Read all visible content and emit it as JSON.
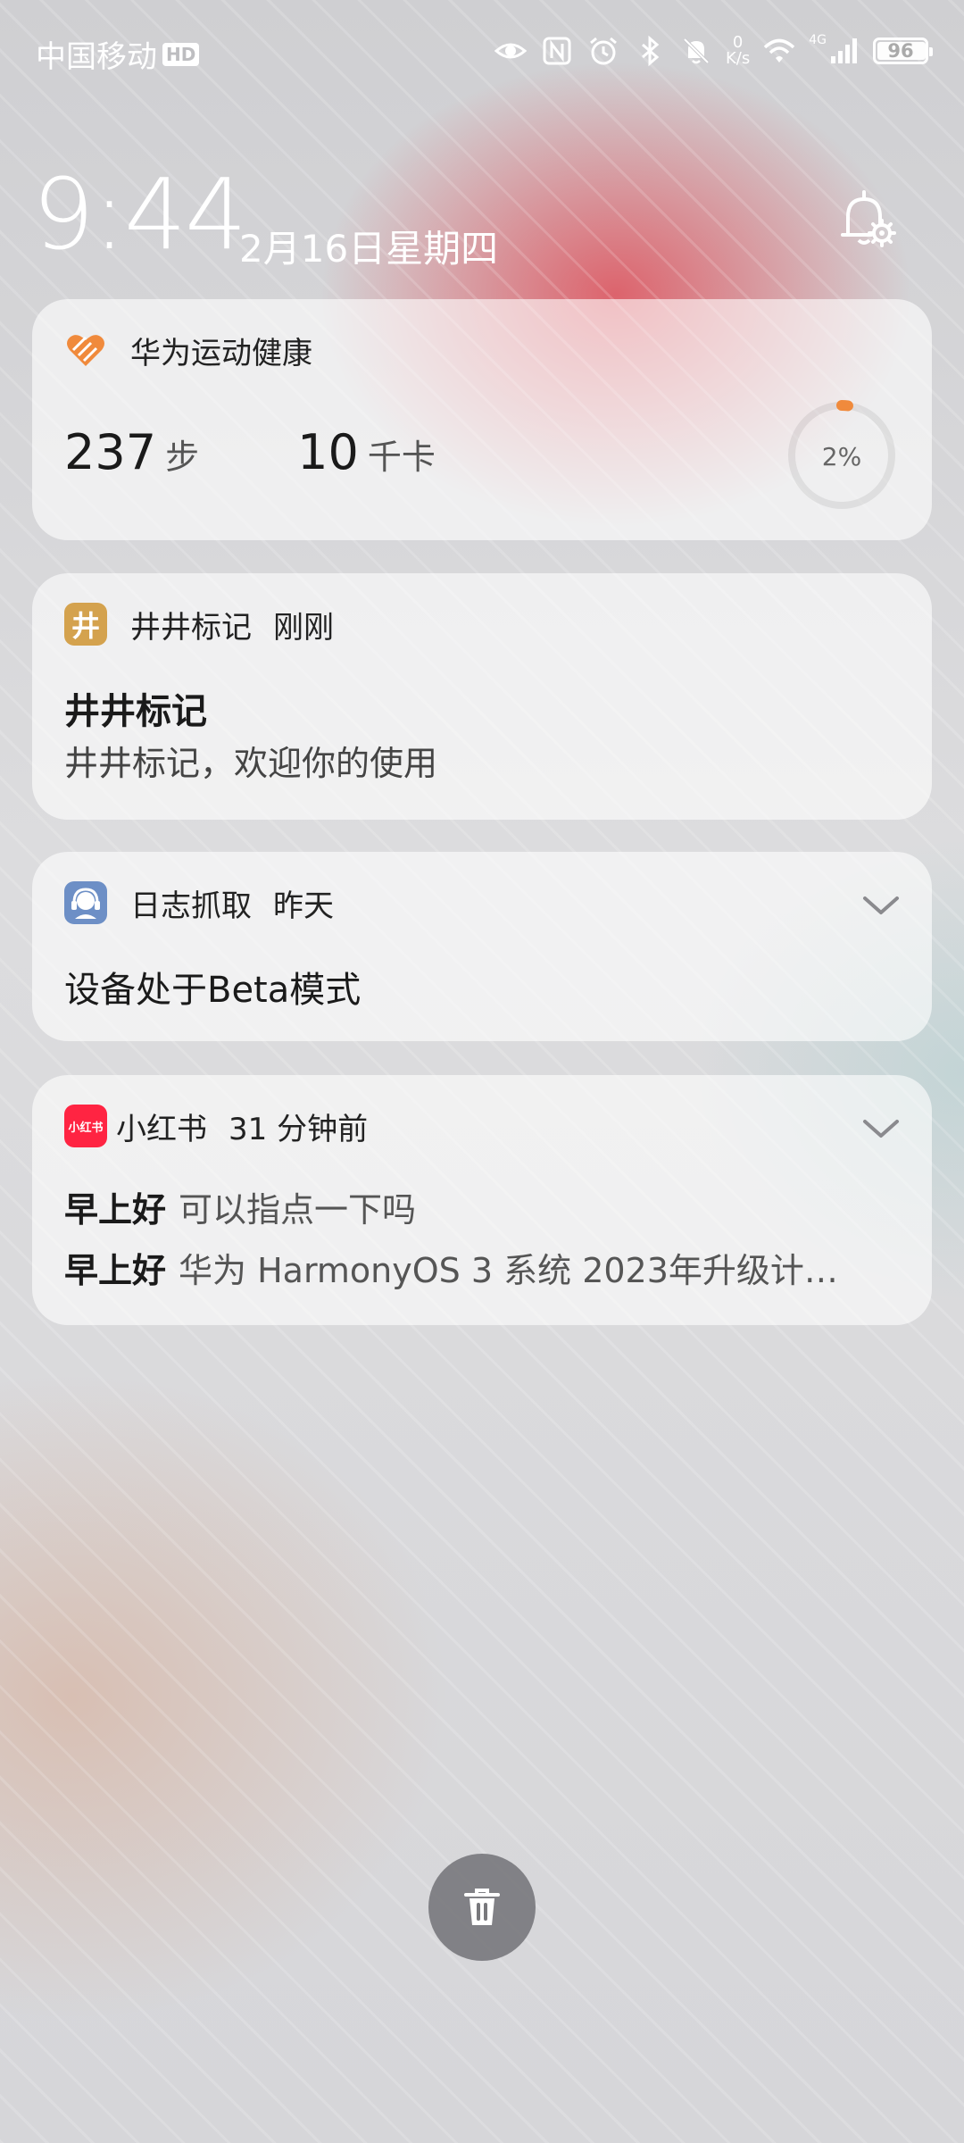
{
  "status_bar": {
    "carrier": "中国移动",
    "hd_badge": "HD",
    "net_speed_value": "0",
    "net_speed_unit": "K/s",
    "network_type": "4G",
    "battery": "96",
    "battery_level": 0.96,
    "icons": [
      "eye-icon",
      "nfc-icon",
      "alarm-icon",
      "bluetooth-icon",
      "mute-bell-icon",
      "wifi-icon",
      "signal-icon",
      "battery-icon"
    ]
  },
  "lockscreen": {
    "time": "9:44",
    "date": "2月16日星期四"
  },
  "notifications": {
    "health": {
      "app_name": "华为运动健康",
      "steps_value": "237",
      "steps_unit": "步",
      "calories_value": "10",
      "calories_unit": "千卡",
      "progress_label": "2%",
      "progress": 0.02,
      "accent_color": "#f08a3c"
    },
    "jingjing": {
      "app_name": "井井标记",
      "time": "刚刚",
      "icon_char": "井",
      "title": "井井标记",
      "body": "井井标记，欢迎你的使用"
    },
    "log": {
      "app_name": "日志抓取",
      "time": "昨天",
      "title": "设备处于Beta模式"
    },
    "xhs": {
      "app_name": "小红书",
      "time": "31 分钟前",
      "icon_text": "小红书",
      "icon_color": "#ff2442",
      "messages": [
        {
          "sender": "早上好",
          "text": "可以指点一下吗"
        },
        {
          "sender": "早上好",
          "text": "华为 HarmonyOS 3 系统 2023年升级计…"
        }
      ]
    }
  }
}
